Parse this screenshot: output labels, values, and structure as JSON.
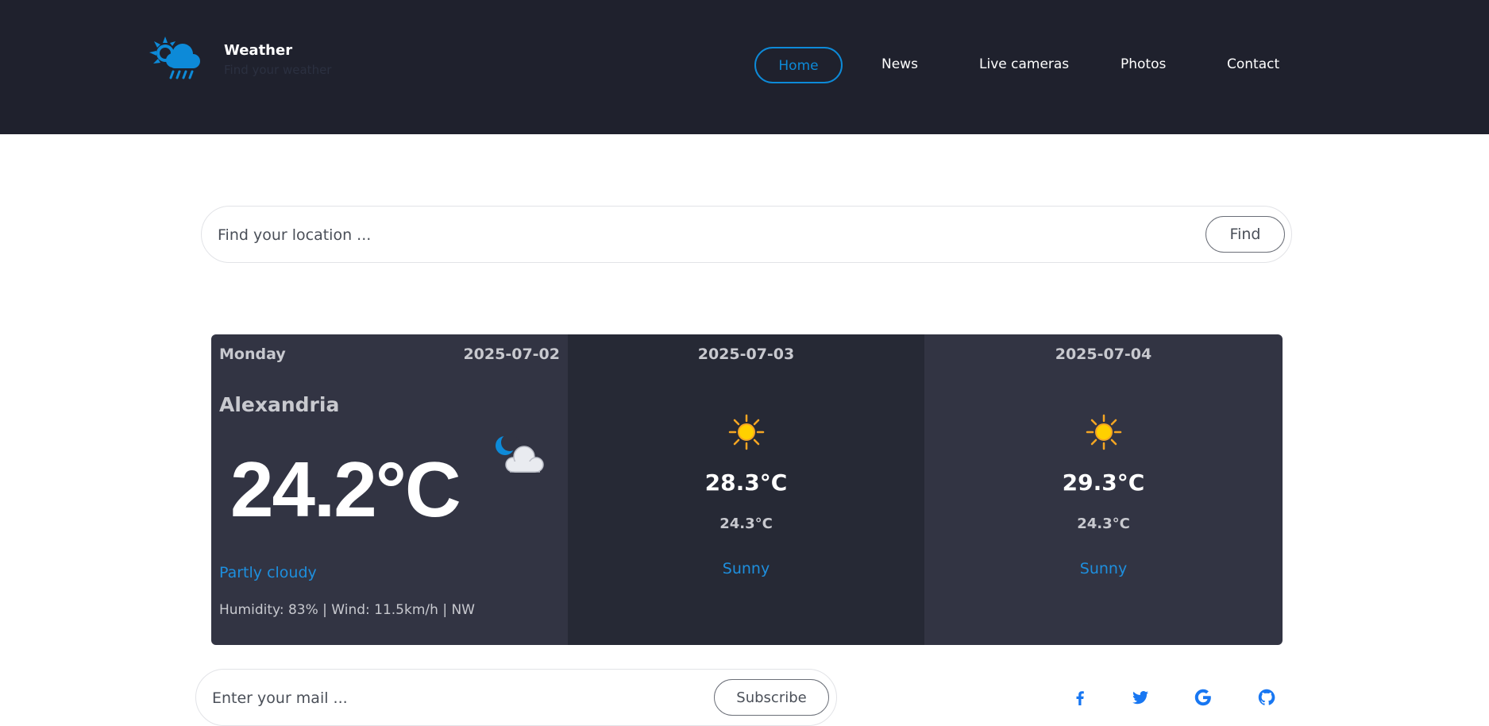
{
  "brand": {
    "title": "Weather",
    "tagline": "Find your weather",
    "icon": "cloud-sun-rain-icon",
    "accent_color": "#0d8ad8"
  },
  "nav": {
    "items": [
      {
        "label": "Home",
        "active": true
      },
      {
        "label": "News",
        "active": false
      },
      {
        "label": "Live cameras",
        "active": false
      },
      {
        "label": "Photos",
        "active": false
      },
      {
        "label": "Contact",
        "active": false
      }
    ]
  },
  "search": {
    "placeholder": "Find your location ...",
    "value": "",
    "button_label": "Find"
  },
  "forecast": {
    "today": {
      "day": "Monday",
      "date": "2025-07-02",
      "city": "Alexandria",
      "temperature": "24.2°C",
      "condition": "Partly cloudy",
      "details": "Humidity: 83% | Wind: 11.5km/h | NW",
      "icon": "moon-cloud-icon"
    },
    "days": [
      {
        "date": "2025-07-03",
        "max_temp": "28.3°C",
        "min_temp": "24.3°C",
        "condition": "Sunny",
        "icon": "sun-icon"
      },
      {
        "date": "2025-07-04",
        "max_temp": "29.3°C",
        "min_temp": "24.3°C",
        "condition": "Sunny",
        "icon": "sun-icon"
      }
    ]
  },
  "subscribe": {
    "placeholder": "Enter your mail ...",
    "value": "",
    "button_label": "Subscribe"
  },
  "social": {
    "icons": [
      "facebook-icon",
      "twitter-icon",
      "google-icon",
      "github-icon"
    ],
    "color": "#1877f2"
  },
  "colors": {
    "header_bg": "#1f212d",
    "card_dark": "#262935",
    "card_light": "#323443",
    "condition_text": "#1e8fde"
  }
}
